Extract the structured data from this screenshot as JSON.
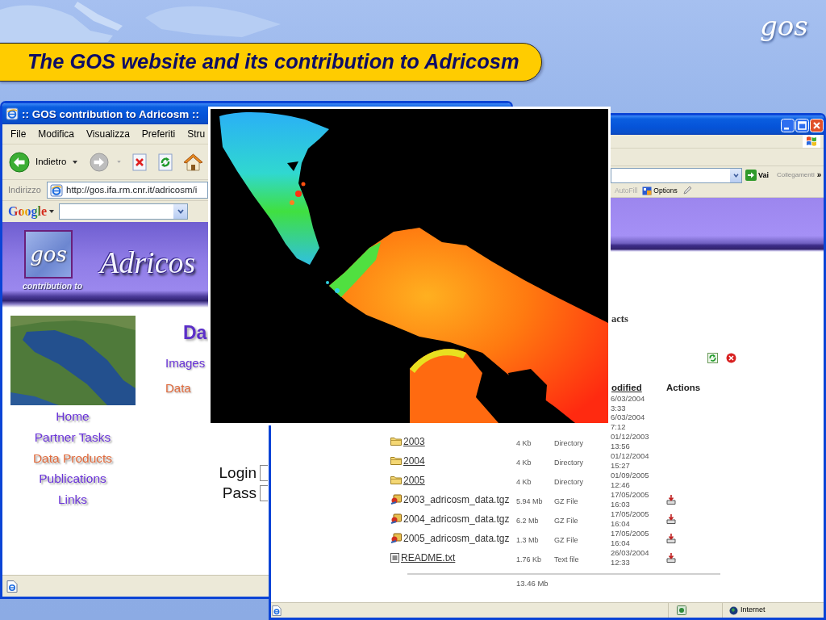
{
  "slide": {
    "title": "The GOS website and its contribution to Adricosm",
    "logo": "gos"
  },
  "left_browser": {
    "title": ":: GOS contribution to Adricosm ::",
    "menu": [
      "File",
      "Modifica",
      "Visualizza",
      "Preferiti",
      "Stru"
    ],
    "back_label": "Indietro",
    "address_label": "Indirizzo",
    "address": "http://gos.ifa.rm.cnr.it/adricosm/i",
    "search_brand": "Google",
    "page": {
      "banner": {
        "logo": "gos",
        "tagline": "contribution to",
        "title": "Adricos"
      },
      "heading": "Da",
      "sections": [
        {
          "label": "Images",
          "selected": false
        },
        {
          "label": "Data",
          "selected": true
        }
      ],
      "nav": [
        {
          "label": "Home",
          "selected": false
        },
        {
          "label": "Partner Tasks",
          "selected": false
        },
        {
          "label": "Data Products",
          "selected": true
        },
        {
          "label": "Publications",
          "selected": false
        },
        {
          "label": "Links",
          "selected": false
        }
      ],
      "login": {
        "user_label": "Login",
        "password_label": "Pass"
      }
    }
  },
  "right_browser": {
    "go_label": "Vai",
    "links_label": "Collegamenti",
    "links_more": "»",
    "toolbar": [
      {
        "kind": "autofill",
        "label": "AutoFill",
        "disabled": true
      },
      {
        "kind": "options",
        "label": "Options",
        "disabled": false
      }
    ],
    "page": {
      "heading": "acts",
      "columns": [
        "odified",
        "Actions"
      ],
      "rows": [
        {
          "date": "6/03/2004 3:33",
          "download": false
        },
        {
          "date": "6/03/2004 7:12",
          "download": false
        },
        {
          "kind": "folder",
          "file": "2003",
          "size": "4 Kb",
          "type": "Directory",
          "date": "01/12/2003 13:56",
          "download": false
        },
        {
          "kind": "folder",
          "file": "2004",
          "size": "4 Kb",
          "type": "Directory",
          "date": "01/12/2004 15:27",
          "download": false
        },
        {
          "kind": "folder",
          "file": "2005",
          "size": "4 Kb",
          "type": "Directory",
          "date": "01/09/2005 12:46",
          "download": false
        },
        {
          "kind": "archive",
          "file": "2003_adricosm_data.tgz",
          "size": "5.94 Mb",
          "type": "GZ File",
          "date": "17/05/2005 16:03",
          "download": true
        },
        {
          "kind": "archive",
          "file": "2004_adricosm_data.tgz",
          "size": "6.2 Mb",
          "type": "GZ File",
          "date": "17/05/2005 16:04",
          "download": true
        },
        {
          "kind": "archive",
          "file": "2005_adricosm_data.tgz",
          "size": "1.3 Mb",
          "type": "GZ File",
          "date": "17/05/2005 16:04",
          "download": true
        },
        {
          "kind": "text",
          "file": "README.txt",
          "size": "1.76 Kb",
          "type": "Text file",
          "date": "26/03/2004 12:33",
          "download": true
        }
      ],
      "total": "13.46 Mb"
    },
    "status_bar": {
      "zone": "Internet"
    }
  }
}
